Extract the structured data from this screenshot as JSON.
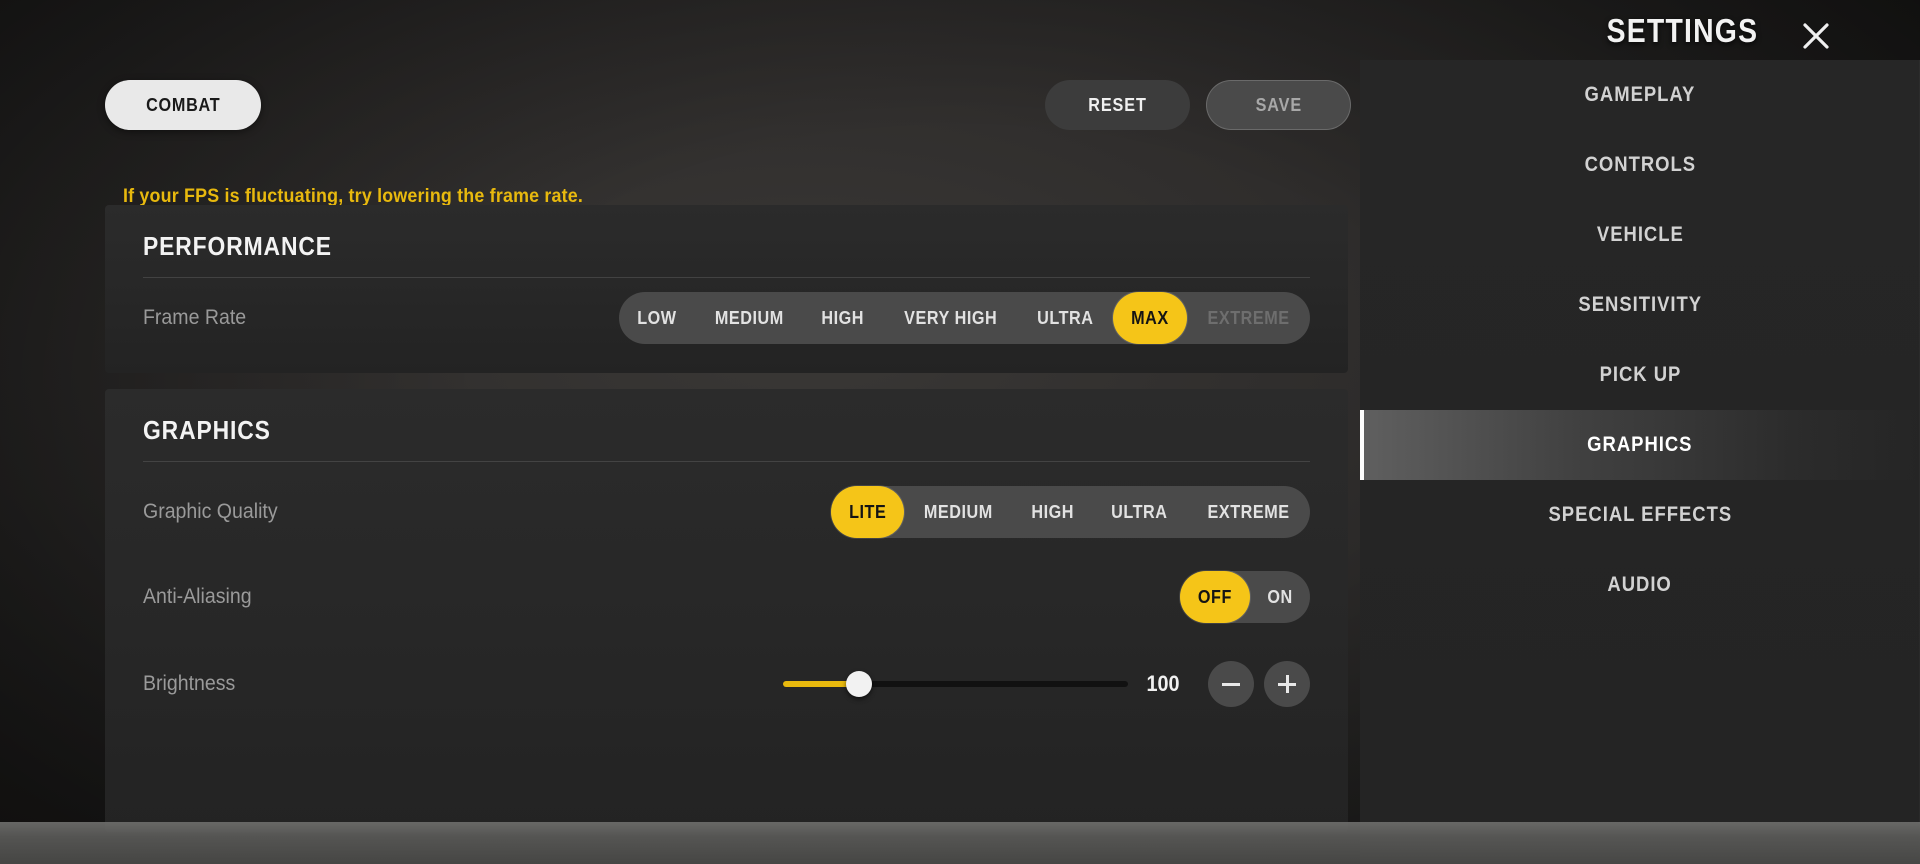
{
  "header": {
    "title": "SETTINGS",
    "close_icon": "close-icon"
  },
  "toolbar": {
    "tab_label": "COMBAT",
    "reset_label": "RESET",
    "save_label": "SAVE"
  },
  "notice": {
    "text": "If your FPS is fluctuating, try lowering the frame rate.",
    "color": "#e8b90e"
  },
  "sidebar": {
    "items": [
      {
        "label": "GAMEPLAY",
        "active": false
      },
      {
        "label": "CONTROLS",
        "active": false
      },
      {
        "label": "VEHICLE",
        "active": false
      },
      {
        "label": "SENSITIVITY",
        "active": false
      },
      {
        "label": "PICK UP",
        "active": false
      },
      {
        "label": "GRAPHICS",
        "active": true
      },
      {
        "label": "SPECIAL EFFECTS",
        "active": false
      },
      {
        "label": "AUDIO",
        "active": false
      }
    ]
  },
  "sections": [
    {
      "title": "PERFORMANCE",
      "rows": [
        {
          "label": "Frame Rate",
          "type": "segmented",
          "options": [
            {
              "label": "LOW",
              "state": "normal"
            },
            {
              "label": "MEDIUM",
              "state": "normal"
            },
            {
              "label": "HIGH",
              "state": "normal"
            },
            {
              "label": "VERY HIGH",
              "state": "normal"
            },
            {
              "label": "ULTRA",
              "state": "normal"
            },
            {
              "label": "MAX",
              "state": "selected"
            },
            {
              "label": "EXTREME",
              "state": "disabled"
            }
          ]
        }
      ]
    },
    {
      "title": "GRAPHICS",
      "rows": [
        {
          "label": "Graphic Quality",
          "type": "segmented",
          "options": [
            {
              "label": "LITE",
              "state": "selected"
            },
            {
              "label": "MEDIUM",
              "state": "normal"
            },
            {
              "label": "HIGH",
              "state": "normal"
            },
            {
              "label": "ULTRA",
              "state": "normal"
            },
            {
              "label": "EXTREME",
              "state": "normal"
            }
          ]
        },
        {
          "label": "Anti-Aliasing",
          "type": "segmented",
          "options": [
            {
              "label": "OFF",
              "state": "selected"
            },
            {
              "label": "ON",
              "state": "normal"
            }
          ]
        },
        {
          "label": "Brightness",
          "type": "slider",
          "value": "100",
          "fill_percent": 22,
          "minus_label": "−",
          "plus_label": "+"
        }
      ]
    }
  ],
  "colors": {
    "accent": "#f5c518",
    "accent_text": "#e8b90e",
    "panel": "#2b2b2b",
    "track": "#4a4a4a"
  }
}
